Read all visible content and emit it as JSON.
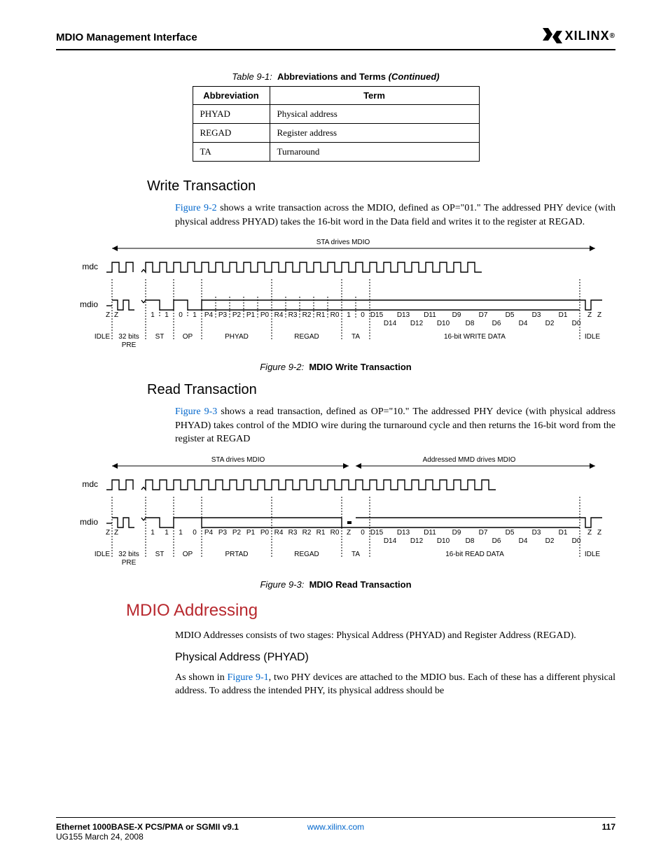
{
  "header": {
    "title": "MDIO Management Interface",
    "brand": "XILINX"
  },
  "table": {
    "caption_prefix": "Table 9-1:",
    "caption_bold": "Abbreviations and Terms",
    "caption_suffix": "(Continued)",
    "head": {
      "c1": "Abbreviation",
      "c2": "Term"
    },
    "rows": [
      {
        "abbrev": "PHYAD",
        "term": "Physical address"
      },
      {
        "abbrev": "REGAD",
        "term": "Register address"
      },
      {
        "abbrev": "TA",
        "term": "Turnaround"
      }
    ]
  },
  "write": {
    "heading": "Write Transaction",
    "figref": "Figure 9-2",
    "para_rest": " shows a write transaction across the MDIO, defined as OP=\"01.\" The addressed PHY device (with physical address PHYAD) takes the 16-bit word in the Data field and writes it to the register at REGAD.",
    "caption_prefix": "Figure 9-2:",
    "caption_bold": "MDIO Write Transaction"
  },
  "read": {
    "heading": "Read Transaction",
    "figref": "Figure 9-3",
    "para_rest": " shows a read transaction, defined as OP=\"10.\" The addressed PHY device (with physical address PHYAD) takes control of the MDIO wire during the turnaround cycle and then returns the 16-bit word from the register at REGAD",
    "caption_prefix": "Figure 9-3:",
    "caption_bold": "MDIO Read Transaction"
  },
  "addr": {
    "heading": "MDIO Addressing",
    "para1": "MDIO Addresses consists of two stages: Physical Address (PHYAD) and Register Address (REGAD).",
    "sub1": "Physical Address (PHYAD)",
    "para2_pre": "As shown in ",
    "para2_ref": "Figure 9-1",
    "para2_post": ", two PHY devices are attached to the MDIO bus. Each of these has a different physical address. To address the intended PHY, its physical address should be"
  },
  "diag_common": {
    "mdc": "mdc",
    "mdio": "mdio",
    "sta": "STA drives MDIO",
    "mmd": "Addressed MMD drives MDIO",
    "idle": "IDLE",
    "pre": "32 bits",
    "pre2": "PRE",
    "st": "ST",
    "op": "OP",
    "phyad": "PHYAD",
    "prtad": "PRTAD",
    "regad": "REGAD",
    "ta": "TA",
    "wdata": "16-bit WRITE DATA",
    "rdata": "16-bit READ DATA"
  },
  "footer": {
    "left1": "Ethernet 1000BASE-X PCS/PMA or SGMII v9.1",
    "left2": "UG155 March 24, 2008",
    "center": "www.xilinx.com",
    "right": "117"
  }
}
